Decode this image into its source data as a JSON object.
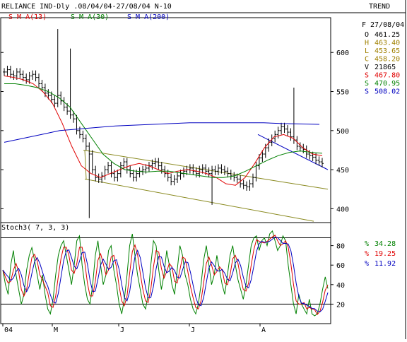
{
  "header": {
    "title": "RELIANCE IND-Dly .08/04/04-27/08/04  N-10",
    "mode": "TREND",
    "sma_labels": [
      {
        "text": "S M A(13)",
        "color": "#e00000"
      },
      {
        "text": "S M A(30)",
        "color": "#008000"
      },
      {
        "text": "S M A(200)",
        "color": "#0000c0"
      }
    ]
  },
  "readout": {
    "date": "F 27/08/04",
    "rows": [
      {
        "key": "O",
        "value": "461.25",
        "color": "#000000"
      },
      {
        "key": "H",
        "value": "463.40",
        "color": "#a08000"
      },
      {
        "key": "L",
        "value": "453.65",
        "color": "#a08000"
      },
      {
        "key": "C",
        "value": "458.20",
        "color": "#a08000"
      },
      {
        "key": "V",
        "value": "21865",
        "color": "#000000"
      },
      {
        "key": "S",
        "value": "467.80",
        "color": "#e00000"
      },
      {
        "key": "S",
        "value": "470.95",
        "color": "#008000"
      },
      {
        "key": "S",
        "value": "508.02",
        "color": "#0000c0"
      }
    ]
  },
  "stoch": {
    "label": "Stoch3( 7, 3, 3)",
    "ticks": [
      80,
      60,
      40,
      20
    ],
    "levels": [
      88,
      20
    ],
    "readout": [
      {
        "key": "%",
        "value": "34.28",
        "color": "#008000"
      },
      {
        "key": "%",
        "value": "19.25",
        "color": "#e00000"
      },
      {
        "key": "%",
        "value": "11.92",
        "color": "#0000c0"
      }
    ],
    "k_fast": [
      55,
      40,
      30,
      60,
      75,
      50,
      35,
      20,
      30,
      55,
      70,
      78,
      65,
      50,
      35,
      50,
      30,
      15,
      10,
      25,
      50,
      70,
      80,
      85,
      70,
      55,
      40,
      60,
      85,
      90,
      60,
      40,
      25,
      20,
      40,
      70,
      85,
      60,
      40,
      50,
      75,
      80,
      55,
      40,
      20,
      10,
      25,
      50,
      80,
      92,
      70,
      50,
      35,
      20,
      15,
      30,
      60,
      85,
      80,
      55,
      35,
      50,
      75,
      60,
      40,
      30,
      55,
      80,
      70,
      50,
      40,
      25,
      15,
      10,
      20,
      40,
      65,
      80,
      60,
      40,
      50,
      70,
      55,
      40,
      30,
      50,
      70,
      80,
      60,
      45,
      35,
      25,
      40,
      60,
      80,
      88,
      90,
      75,
      85,
      88,
      80,
      92,
      95,
      85,
      75,
      80,
      90,
      85,
      60,
      40,
      20,
      10,
      30,
      20,
      15,
      10,
      25,
      10,
      8,
      10,
      20,
      35,
      48,
      36
    ]
  },
  "axes": {
    "price_ticks": [
      600,
      550,
      500,
      450,
      400
    ],
    "x_months": [
      "04",
      "M",
      "J",
      "J",
      "A"
    ]
  },
  "chart_data": {
    "type": "line",
    "title": "RELIANCE IND-Dly .08/04/04-27/08/04  N-10",
    "price_axis": {
      "ylim": [
        385,
        640
      ],
      "ticks": [
        600,
        550,
        500,
        450,
        400
      ]
    },
    "stoch_axis": {
      "ylim": [
        0,
        100
      ],
      "ticks": [
        80,
        60,
        40,
        20
      ]
    },
    "ohlc_close": [
      575,
      578,
      572,
      570,
      575,
      572,
      568,
      565,
      570,
      572,
      568,
      560,
      555,
      548,
      545,
      540,
      535,
      545,
      538,
      530,
      525,
      520,
      515,
      500,
      495,
      490,
      480,
      470,
      450,
      440,
      438,
      442,
      450,
      455,
      445,
      440,
      445,
      455,
      460,
      450,
      445,
      440,
      445,
      448,
      450,
      452,
      455,
      458,
      460,
      455,
      450,
      445,
      440,
      435,
      438,
      442,
      445,
      448,
      450,
      452,
      448,
      445,
      450,
      452,
      448,
      445,
      450,
      448,
      452,
      450,
      448,
      445,
      442,
      440,
      438,
      432,
      430,
      428,
      432,
      440,
      455,
      465,
      470,
      478,
      485,
      490,
      495,
      500,
      505,
      502,
      498,
      492,
      488,
      480,
      478,
      476,
      470,
      468,
      466,
      462,
      460,
      458
    ],
    "series": [
      {
        "name": "S M A(13)",
        "color": "#e00000",
        "values": [
          570,
          568,
          565,
          560,
          550,
          535,
          510,
          480,
          455,
          445,
          440,
          445,
          450,
          455,
          458,
          455,
          450,
          445,
          448,
          450,
          448,
          445,
          440,
          432,
          430,
          440,
          458,
          478,
          492,
          495,
          490,
          478,
          470,
          467.8
        ]
      },
      {
        "name": "S M A(30)",
        "color": "#008000",
        "values": [
          560,
          560,
          558,
          555,
          550,
          542,
          530,
          510,
          490,
          470,
          458,
          450,
          448,
          447,
          448,
          448,
          446,
          444,
          442,
          440,
          440,
          442,
          448,
          455,
          462,
          468,
          472,
          474,
          472,
          470.95
        ]
      },
      {
        "name": "S M A(200)",
        "color": "#0000c0",
        "values": [
          485,
          490,
          495,
          500,
          502,
          504,
          506,
          507,
          508,
          509,
          510,
          510,
          510,
          510,
          510,
          509,
          508.5,
          508.02
        ]
      }
    ]
  }
}
